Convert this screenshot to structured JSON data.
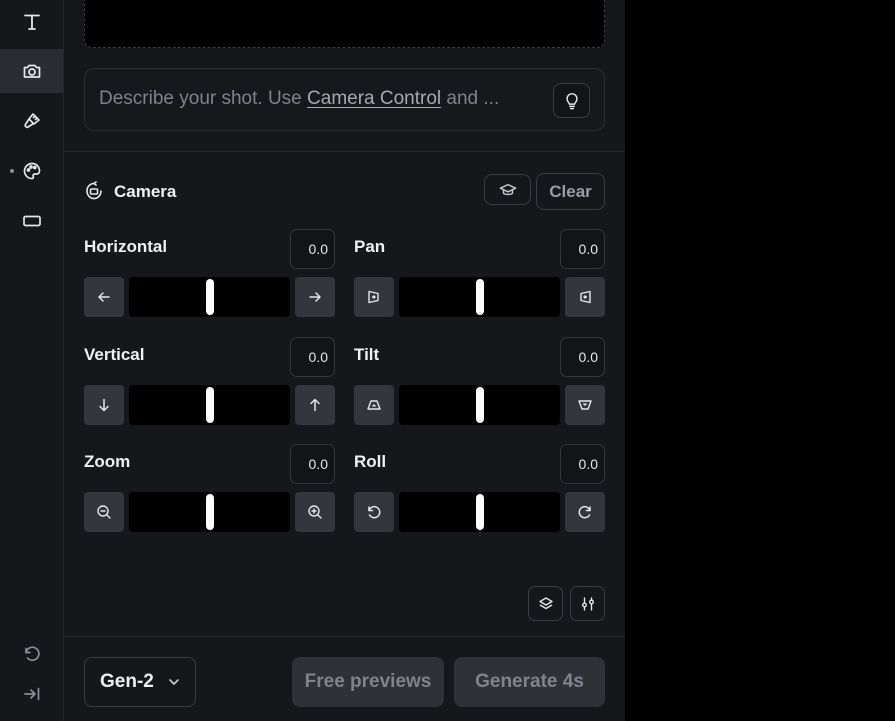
{
  "rail": {
    "items": [
      {
        "icon": "text-icon",
        "active": false
      },
      {
        "icon": "camera-icon",
        "active": true
      },
      {
        "icon": "brush-icon",
        "active": false
      },
      {
        "icon": "palette-icon",
        "active": false
      },
      {
        "icon": "aspect-ratio-icon",
        "active": false
      }
    ],
    "bottom": [
      {
        "icon": "undo-icon"
      },
      {
        "icon": "collapse-icon"
      }
    ]
  },
  "prompt": {
    "prefix": "Describe your shot. Use ",
    "link": "Camera Control",
    "suffix": " and ..."
  },
  "camera": {
    "title": "Camera",
    "clear_label": "Clear",
    "controls": [
      {
        "label": "Horizontal",
        "value": "0.0",
        "level": 0.5,
        "left_icon": "arrow-left-icon",
        "right_icon": "arrow-right-icon"
      },
      {
        "label": "Pan",
        "value": "0.0",
        "level": 0.5,
        "left_icon": "pan-left-icon",
        "right_icon": "pan-right-icon"
      },
      {
        "label": "Vertical",
        "value": "0.0",
        "level": 0.5,
        "left_icon": "arrow-down-icon",
        "right_icon": "arrow-up-icon"
      },
      {
        "label": "Tilt",
        "value": "0.0",
        "level": 0.5,
        "left_icon": "tilt-up-icon",
        "right_icon": "tilt-down-icon"
      },
      {
        "label": "Zoom",
        "value": "0.0",
        "level": 0.5,
        "left_icon": "zoom-out-icon",
        "right_icon": "zoom-in-icon"
      },
      {
        "label": "Roll",
        "value": "0.0",
        "level": 0.5,
        "left_icon": "rotate-ccw-icon",
        "right_icon": "rotate-cw-icon"
      }
    ]
  },
  "footer": {
    "model": "Gen-2",
    "free_previews_label": "Free previews",
    "generate_label": "Generate 4s"
  }
}
